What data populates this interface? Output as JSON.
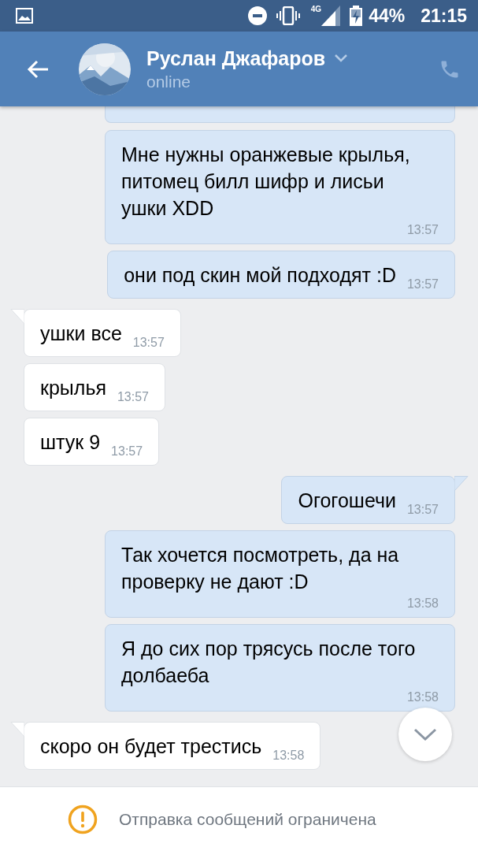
{
  "status_bar": {
    "network": "4G",
    "battery": "44%",
    "time": "21:15"
  },
  "header": {
    "name": "Руслан Джафаров",
    "status": "online"
  },
  "messages": [
    {
      "kind": "outgoing",
      "text": "Мне нужны оранжевые крылья,\nпитомец билл шифр и лисьи\nушки XDD",
      "time": "13:57",
      "tail": false
    },
    {
      "kind": "outgoing",
      "text": "они под скин мой подходят :D",
      "time": "13:57",
      "tail": false
    },
    {
      "kind": "incoming",
      "text": "ушки все",
      "time": "13:57",
      "tail": true
    },
    {
      "kind": "incoming",
      "text": "крылья",
      "time": "13:57",
      "tail": false
    },
    {
      "kind": "incoming",
      "text": "штук 9",
      "time": "13:57",
      "tail": false
    },
    {
      "kind": "outgoing",
      "text": "Огогошечи",
      "time": "13:57",
      "tail": true
    },
    {
      "kind": "outgoing",
      "text": "Так хочется посмотреть, да на\nпроверку не дают :D",
      "time": "13:58",
      "tail": false
    },
    {
      "kind": "outgoing",
      "text": "Я до сих пор трясусь после того\nдолбаеба",
      "time": "13:58",
      "tail": false
    },
    {
      "kind": "incoming",
      "text": "скоро он будет трестись",
      "time": "13:58",
      "tail": true
    }
  ],
  "notice": "Отправка сообщений ограничена"
}
